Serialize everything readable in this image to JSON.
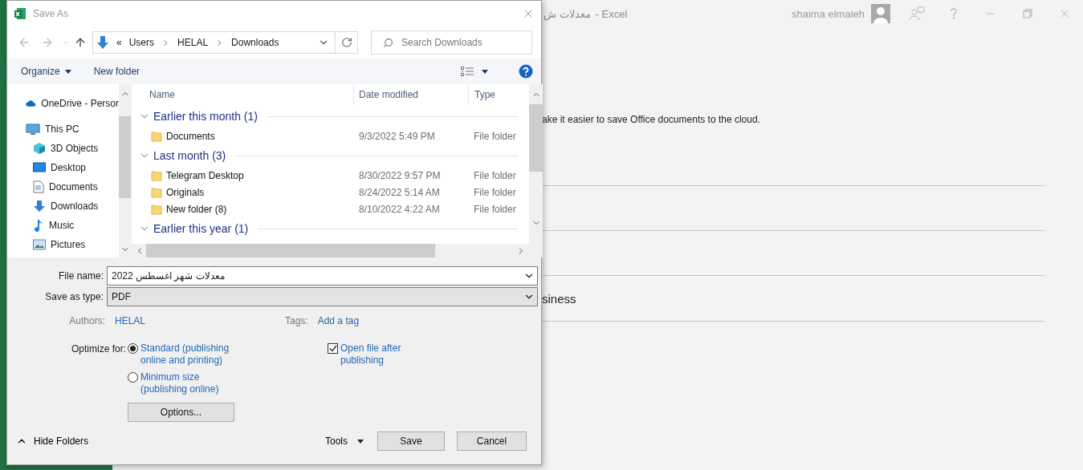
{
  "app": {
    "title_fragment": "معدلات ش",
    "title_suffix": "-  Excel",
    "user": "shaima elmaleh",
    "body_text": "ake it easier to save Office documents to the cloud.",
    "option_fragment": "siness"
  },
  "dialog": {
    "title": "Save As",
    "address": {
      "overflow": "«",
      "parts": [
        "Users",
        "HELAL",
        "Downloads"
      ]
    },
    "search": {
      "placeholder": "Search Downloads"
    },
    "toolbar": {
      "organize": "Organize",
      "new_folder": "New folder"
    },
    "nav_pane": [
      {
        "label": "OneDrive - Persor"
      },
      {
        "label": "This PC",
        "children": [
          {
            "label": "3D Objects"
          },
          {
            "label": "Desktop"
          },
          {
            "label": "Documents"
          },
          {
            "label": "Downloads"
          },
          {
            "label": "Music"
          },
          {
            "label": "Pictures"
          }
        ]
      }
    ],
    "columns": [
      "Name",
      "Date modified",
      "Type"
    ],
    "groups": [
      {
        "label": "Earlier this month (1)",
        "expanded": true,
        "items": [
          {
            "name": "Documents",
            "date": "9/3/2022 5:49 PM",
            "type": "File folder"
          }
        ]
      },
      {
        "label": "Last month (3)",
        "expanded": true,
        "items": [
          {
            "name": "Telegram Desktop",
            "date": "8/30/2022 9:57 PM",
            "type": "File folder"
          },
          {
            "name": "Originals",
            "date": "8/24/2022 5:14 AM",
            "type": "File folder"
          },
          {
            "name": "New folder (8)",
            "date": "8/10/2022 4:22 AM",
            "type": "File folder"
          }
        ]
      },
      {
        "label": "Earlier this year (1)",
        "expanded": true
      }
    ],
    "file_name": {
      "label": "File name:",
      "value": "معدلات شهر اغسطس 2022"
    },
    "save_type": {
      "label": "Save as type:",
      "value": "PDF"
    },
    "authors": {
      "label": "Authors:",
      "value": "HELAL"
    },
    "tags": {
      "label": "Tags:",
      "value": "Add a tag"
    },
    "optimize": {
      "label": "Optimize for:",
      "options": [
        {
          "label": "Standard (publishing\nonline and printing)",
          "selected": true
        },
        {
          "label": "Minimum size\n(publishing online)",
          "selected": false
        }
      ]
    },
    "open_after": {
      "label": "Open file after\npublishing",
      "checked": true
    },
    "options_button": "Options...",
    "hide_folders": "Hide Folders",
    "tools": "Tools",
    "buttons": [
      "Save",
      "Cancel"
    ]
  }
}
